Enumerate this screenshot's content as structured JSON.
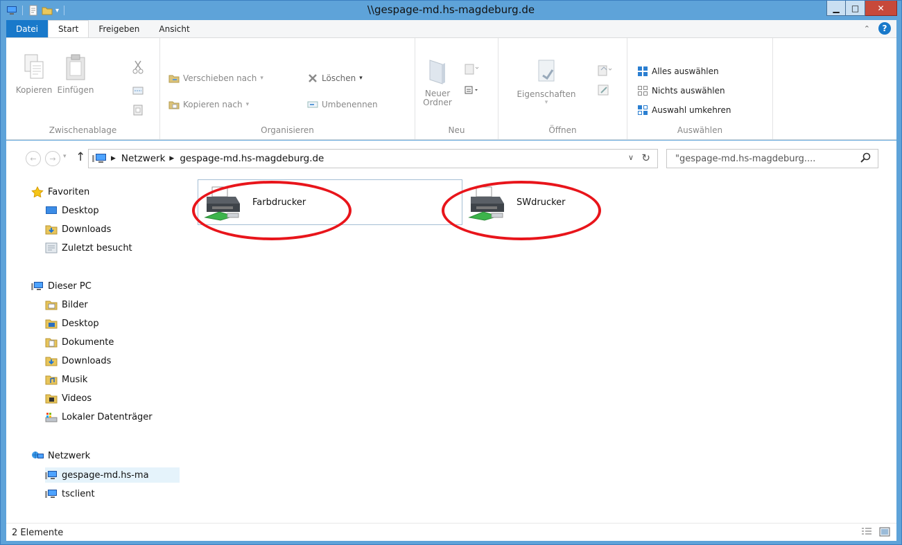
{
  "window": {
    "title": "\\\\gespage-md.hs-magdeburg.de",
    "minimize_label": "▁",
    "maximize_label": "□",
    "close_label": "✕"
  },
  "ribbon_tabs": [
    "Datei",
    "Start",
    "Freigeben",
    "Ansicht"
  ],
  "ribbon": {
    "clipboard": {
      "label": "Zwischenablage",
      "copy": "Kopieren",
      "paste": "Einfügen"
    },
    "organize": {
      "label": "Organisieren",
      "move_to": "Verschieben nach",
      "copy_to": "Kopieren nach",
      "delete": "Löschen",
      "rename": "Umbenennen"
    },
    "new": {
      "label": "Neu",
      "new_folder_line1": "Neuer",
      "new_folder_line2": "Ordner"
    },
    "open": {
      "label": "Öffnen",
      "properties": "Eigenschaften"
    },
    "select": {
      "label": "Auswählen",
      "select_all": "Alles auswählen",
      "select_none": "Nichts auswählen",
      "invert": "Auswahl umkehren"
    }
  },
  "address": {
    "crumbs": [
      "Netzwerk",
      "gespage-md.hs-magdeburg.de"
    ]
  },
  "search": {
    "text": "\"gespage-md.hs-magdeburg...."
  },
  "navpane": {
    "favorites": "Favoriten",
    "fav_items": [
      "Desktop",
      "Downloads",
      "Zuletzt besucht"
    ],
    "this_pc": "Dieser PC",
    "pc_items": [
      "Bilder",
      "Desktop",
      "Dokumente",
      "Downloads",
      "Musik",
      "Videos",
      "Lokaler Datenträger"
    ],
    "network": "Netzwerk",
    "net_items": [
      "gespage-md.hs-ma",
      "tsclient"
    ]
  },
  "files": [
    {
      "name": "Farbdrucker"
    },
    {
      "name": "SWdrucker"
    }
  ],
  "status": {
    "count": "2 Elemente"
  },
  "colors": {
    "accent": "#1979ca",
    "title_bar": "#5ea3d9",
    "highlight_ring": "#e8151b"
  }
}
